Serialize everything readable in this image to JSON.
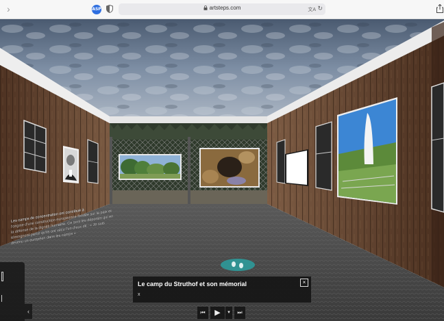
{
  "browser": {
    "forward_glyph": "›",
    "extension_badge": "ASP",
    "url": "artsteps.com",
    "translate_glyph": "文A",
    "reload_glyph": "↻"
  },
  "gallery": {
    "wall_text_line1": "Les camps de concentration ont contribué à",
    "wall_text_rest": "l'origine d'une construction européenne fondée sur la paix et la défense de la dignité humaine. Ce sont les déportés qui en témoignent parce qu'ils ont vécu l'un d'eux dit : « Je suis devenu un européen dans les camps »"
  },
  "info_panel": {
    "title": "Le camp du Struthof et son mémorial",
    "subtitle": "x",
    "close_glyph": "×"
  },
  "controls": {
    "prev_glyph": "⏮",
    "play_glyph": "▶",
    "dropdown_glyph": "▾",
    "next_glyph": "⏭"
  },
  "side_panel": {
    "collapse_glyph": "‹"
  }
}
